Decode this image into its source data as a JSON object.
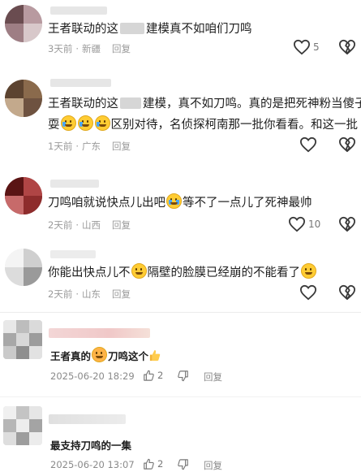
{
  "comments": [
    {
      "text_a": "王者联动的这",
      "text_b": "建模真不如咱们刀鸣",
      "time": "3天前",
      "location": "新疆",
      "reply": "回复",
      "likes": "5"
    },
    {
      "line1_a": "王者联动的这",
      "line1_b": "建模，真不如刀鸣。真的是把死神粉当傻子",
      "line2_a": "耍",
      "line2_b": "区别对待，名侦探柯南那一批你看看。和这一批",
      "time": "1天前",
      "location": "广东",
      "reply": "回复"
    },
    {
      "text_a": "刀鸣咱就说快点儿出吧",
      "text_b": "等不了一点儿了死神最帅",
      "time": "2天前",
      "location": "山西",
      "reply": "回复",
      "likes": "10"
    },
    {
      "text_a": "你能出快点儿不",
      "text_b": "隔壁的脸膜已经崩的不能看了",
      "time": "2天前",
      "location": "山东",
      "reply": "回复"
    },
    {
      "text_a": "王者真的",
      "text_b": "刀鸣这个",
      "time": "2025-06-20 18:29",
      "likes": "2",
      "reply": "回复"
    },
    {
      "text": "最支持刀鸣的一集",
      "time": "2025-06-20 13:07",
      "likes": "2",
      "reply": "回复"
    }
  ],
  "colors": {
    "meta": "#9a9a9a",
    "text": "#1d1d1d",
    "heart_stroke": "#3a3a3a",
    "broken_heart": "#3a3a3a",
    "name_blur_pink": "#f3d6d6"
  },
  "icons": [
    "heart-outline-icon",
    "broken-heart-icon",
    "thumbs-up-icon",
    "thumbs-down-icon",
    "ok-hand-emoji",
    "grin-sweat-emoji",
    "rofl-emoji",
    "sob-emoji",
    "thumbs-up-emoji",
    "grimace-emoji"
  ]
}
